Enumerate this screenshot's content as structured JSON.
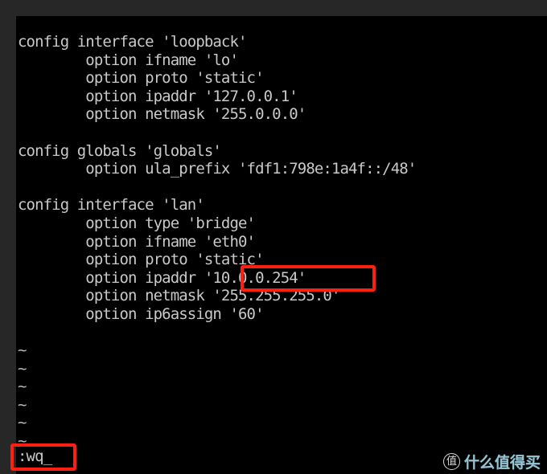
{
  "window": {
    "app": "vim",
    "file_type": "OpenWrt UCI network config",
    "background_color": "#000000",
    "frame_color": "#272727",
    "text_color": "#c9c9c9",
    "highlight_color": "#fe1f11"
  },
  "editor": {
    "lines": [
      {
        "text": "config interface 'loopback'",
        "kind": "config"
      },
      {
        "text": "        option ifname 'lo'",
        "kind": "option"
      },
      {
        "text": "        option proto 'static'",
        "kind": "option"
      },
      {
        "text": "        option ipaddr '127.0.0.1'",
        "kind": "option"
      },
      {
        "text": "        option netmask '255.0.0.0'",
        "kind": "option"
      },
      {
        "text": "",
        "kind": "blank"
      },
      {
        "text": "config globals 'globals'",
        "kind": "config"
      },
      {
        "text": "        option ula_prefix 'fdf1:798e:1a4f::/48'",
        "kind": "option"
      },
      {
        "text": "",
        "kind": "blank"
      },
      {
        "text": "config interface 'lan'",
        "kind": "config"
      },
      {
        "text": "        option type 'bridge'",
        "kind": "option"
      },
      {
        "text": "        option ifname 'eth0'",
        "kind": "option"
      },
      {
        "text": "        option proto 'static'",
        "kind": "option"
      },
      {
        "text": "        option ipaddr '10.0.0.254'",
        "kind": "option"
      },
      {
        "text": "        option netmask '255.255.255.0'",
        "kind": "option"
      },
      {
        "text": "        option ip6assign '60'",
        "kind": "option"
      },
      {
        "text": "",
        "kind": "blank"
      },
      {
        "text": "~",
        "kind": "tilde"
      },
      {
        "text": "~",
        "kind": "tilde"
      },
      {
        "text": "~",
        "kind": "tilde"
      },
      {
        "text": "~",
        "kind": "tilde"
      },
      {
        "text": "~",
        "kind": "tilde"
      },
      {
        "text": "~",
        "kind": "tilde"
      }
    ]
  },
  "highlights": {
    "ipaddr_value": "'10.0.0.254'",
    "command_box": ":wq"
  },
  "command_line": {
    "text": ":wq",
    "cursor": "_"
  },
  "watermark": {
    "logo_glyph": "值",
    "text": "什么值得买",
    "color": "#9fd4e6"
  }
}
